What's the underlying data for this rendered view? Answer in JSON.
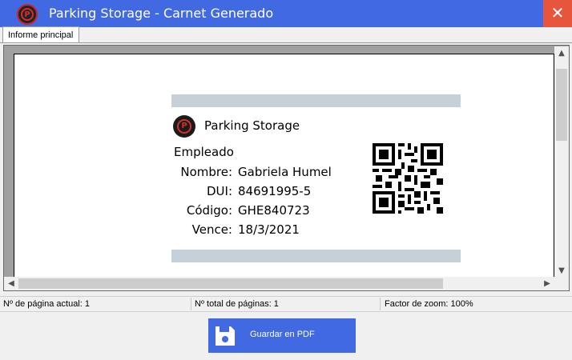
{
  "window": {
    "title": "Parking Storage - Carnet Generado",
    "logo_letter": "P",
    "close_glyph": "✕",
    "accent_color": "#4169e1",
    "close_color": "#e8553d"
  },
  "tabs": [
    {
      "label": "Informe principal",
      "active": true
    }
  ],
  "badge": {
    "company": "Parking Storage",
    "role": "Empleado",
    "fields": [
      {
        "label": "Nombre:",
        "value": "Gabriela Humel"
      },
      {
        "label": "DUI:",
        "value": "84691995-5"
      },
      {
        "label": "Código:",
        "value": "GHE840723"
      },
      {
        "label": "Vence:",
        "value": "18/3/2021"
      }
    ],
    "band_color": "#c5d0d8"
  },
  "scrollbars": {
    "up_arrow": "▲",
    "down_arrow": "▼",
    "left_arrow": "◀",
    "right_arrow": "▶"
  },
  "status": {
    "current_page": "Nº de página actual: 1",
    "total_pages": "Nº total de páginas: 1",
    "zoom": "Factor de zoom: 100%"
  },
  "actions": {
    "save_pdf_label": "Guardar en PDF"
  }
}
